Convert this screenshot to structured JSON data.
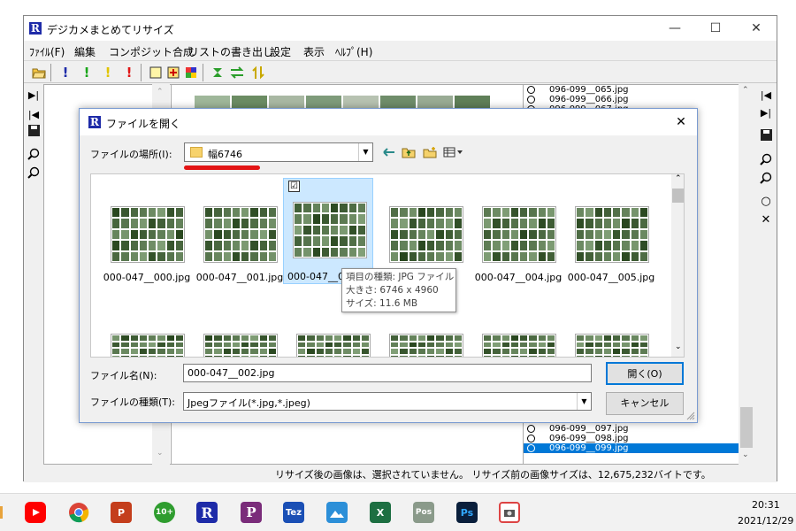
{
  "app": {
    "title": "デジカメまとめてリサイズ",
    "logo_letter": "R",
    "menu": [
      "ﾌｧｲﾙ(F)",
      "編集",
      "コンポジット合成",
      "リストの書き出し",
      "設定",
      "表示",
      "ﾍﾙﾌﾟ(H)"
    ],
    "status_text": "リサイズ後の画像は、選択されていません。 リサイズ前の画像サイズは、12,675,232バイトです。"
  },
  "file_list": {
    "top_items": [
      "096-099__065.jpg",
      "096-099__066.jpg",
      "096-099__067.jpg"
    ],
    "bottom_items": [
      "096-099__097.jpg",
      "096-099__098.jpg",
      "096-099__099.jpg"
    ],
    "selected": "096-099__099.jpg"
  },
  "dialog": {
    "title": "ファイルを開く",
    "look_in_label": "ファイルの場所(I):",
    "look_in_value": "幅6746",
    "files": [
      {
        "name": "000-047__000.jpg",
        "selected": false
      },
      {
        "name": "000-047__001.jpg",
        "selected": false
      },
      {
        "name": "000-047__0",
        "selected": true
      },
      {
        "name": "",
        "selected": false
      },
      {
        "name": "000-047__004.jpg",
        "selected": false
      },
      {
        "name": "000-047__005.jpg",
        "selected": false
      }
    ],
    "tooltip": {
      "type": "項目の種類: JPG ファイル",
      "size": "大きさ: 6746 x 4960",
      "filesize": "サイズ: 11.6 MB"
    },
    "file_name_label": "ファイル名(N):",
    "file_name_value": "000-047__002.jpg",
    "file_type_label": "ファイルの種類(T):",
    "file_type_value": "Jpegファイル(*.jpg,*.jpeg)",
    "open_label": "開く(O)",
    "cancel_label": "キャンセル",
    "check_mark": "☑"
  },
  "taskbar": {
    "icons": [
      "youtube",
      "chrome",
      "powerpoint",
      "calendar-10plus",
      "resize-app",
      "p-app",
      "tez",
      "photos",
      "excel",
      "pos",
      "photoshop",
      "camera-app"
    ],
    "time": "20:31",
    "date": "2021/12/29"
  },
  "colors": {
    "accent": "#0078d7",
    "app_logo": "#1e2ba8",
    "red_mark": "#e31414"
  }
}
